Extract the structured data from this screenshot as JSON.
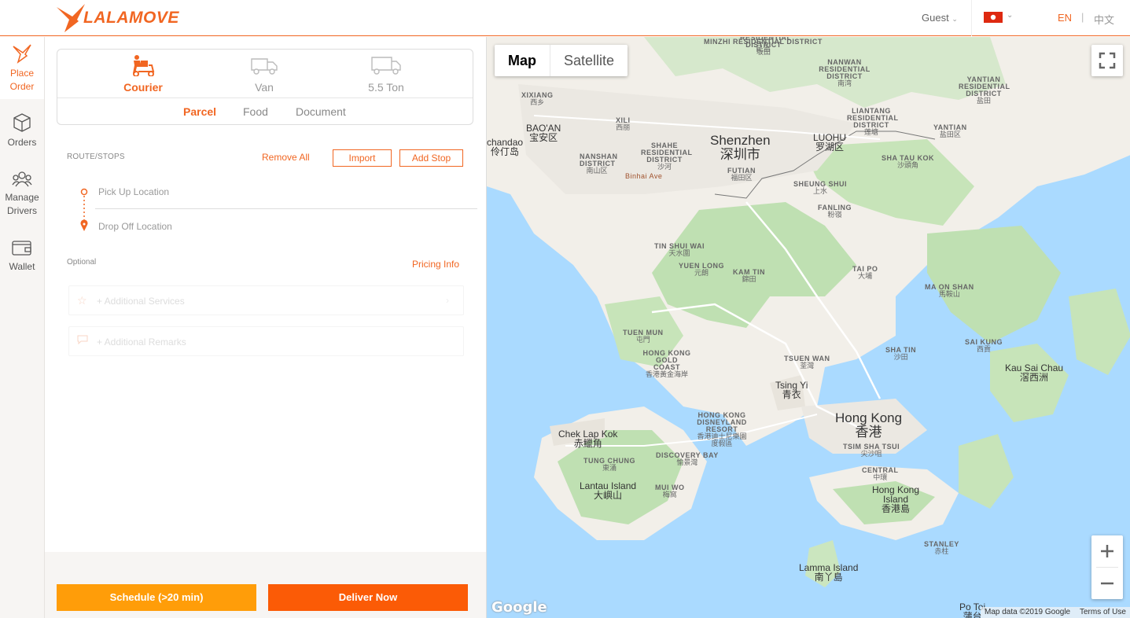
{
  "header": {
    "brand": "LALAMOVE",
    "user": "Guest",
    "lang_en": "EN",
    "lang_sep": "|",
    "lang_zh": "中文",
    "accent_color": "#f16622"
  },
  "nav": {
    "items": [
      {
        "label_1": "Place",
        "label_2": "Order",
        "icon": "bird-icon",
        "active": true
      },
      {
        "label_1": "Orders",
        "icon": "box-icon"
      },
      {
        "label_1": "Manage",
        "label_2": "Drivers",
        "icon": "drivers-icon"
      },
      {
        "label_1": "Wallet",
        "icon": "wallet-icon"
      }
    ]
  },
  "order": {
    "vehicles": [
      {
        "label": "Courier",
        "icon": "courier-icon",
        "active": true
      },
      {
        "label": "Van",
        "icon": "van-icon"
      },
      {
        "label": "5.5 Ton",
        "icon": "truck-icon"
      }
    ],
    "subtypes": [
      {
        "label": "Parcel",
        "active": true
      },
      {
        "label": "Food"
      },
      {
        "label": "Document"
      }
    ],
    "route_label": "ROUTE/STOPS",
    "remove_all": "Remove All",
    "import": "Import",
    "add_stop": "Add Stop",
    "pickup_placeholder": "Pick Up Location",
    "dropoff_placeholder": "Drop Off Location",
    "optional_label": "Optional",
    "pricing_info": "Pricing Info",
    "additional_services": "+ Additional Services",
    "additional_remarks": "+ Additional Remarks",
    "schedule_button": "Schedule (>20 min)",
    "deliver_now_button": "Deliver Now"
  },
  "map": {
    "type_map": "Map",
    "type_satellite": "Satellite",
    "google": "Google",
    "attribution": "Map data ©2019 Google",
    "terms": "Terms of Use",
    "labels": {
      "minzhi": "MINZHI RESIDENTIAL DISTRICT",
      "minzhi_zh": "民治",
      "jihua": "RESIDENTIAL DISTRICT",
      "jihua_zh": "坂田",
      "nanwan": "NANWAN RESIDENTIAL DISTRICT",
      "nanwan_zh": "南湾",
      "yantian_res": "YANTIAN RESIDENTIAL DISTRICT",
      "yantian_res_zh": "盐田",
      "xixiang": "XIXIANG",
      "xixiang_zh": "西乡",
      "baoan": "BAO'AN",
      "baoan_zh": "宝安区",
      "xili": "XILI",
      "xili_zh": "西丽",
      "liantang": "LIANTANG RESIDENTIAL DISTRICT",
      "liantang_zh": "莲塘",
      "yantian": "YANTIAN",
      "yantian_zh": "盐田区",
      "chandao": "chandao",
      "chandao_zh": "伶仃岛",
      "shenzhen": "Shenzhen",
      "shenzhen_zh": "深圳市",
      "luohu": "LUOHU",
      "luohu_zh": "罗湖区",
      "shahe": "SHAHE RESIDENTIAL DISTRICT",
      "shahe_zh": "沙河",
      "nanshan": "NANSHAN DISTRICT",
      "nanshan_zh": "南山区",
      "futian": "FUTIAN",
      "futian_zh": "福田区",
      "binhai": "Binhai Ave",
      "shatau": "SHA TAU KOK",
      "shatau_zh": "沙頭角",
      "sheungshui": "SHEUNG SHUI",
      "sheungshui_zh": "上水",
      "fanling": "FANLING",
      "fanling_zh": "粉嶺",
      "tinshuiwai": "TIN SHUI WAI",
      "tinshuiwai_zh": "天水圍",
      "yuenlong": "YUEN LONG",
      "yuenlong_zh": "元朗",
      "kamtin": "KAM TIN",
      "kamtin_zh": "錦田",
      "taipo": "TAI PO",
      "taipo_zh": "大埔",
      "maonshan": "MA ON SHAN",
      "maonshan_zh": "馬鞍山",
      "tuenmun": "TUEN MUN",
      "tuenmun_zh": "屯門",
      "goldcoast": "HONG KONG GOLD COAST",
      "goldcoast_zh": "香港黃金海岸",
      "shatin": "SHA TIN",
      "shatin_zh": "沙田",
      "saikung": "SAI KUNG",
      "saikung_zh": "西貢",
      "tsuenwan": "TSUEN WAN",
      "tsuenwan_zh": "荃灣",
      "kausaichau": "Kau Sai Chau",
      "kausaichau_zh": "滘西洲",
      "tsingyi": "Tsing Yi",
      "tsingyi_zh": "青衣",
      "disney": "HONG KONG DISNEYLAND RESORT",
      "disney_zh": "香港迪士尼樂園度假區",
      "hongkong": "Hong Kong",
      "hongkong_zh": "香港",
      "cheklapkok": "Chek Lap Kok",
      "cheklapkok_zh": "赤鱲角",
      "tsimshatsui": "TSIM SHA TSUI",
      "tsimshatsui_zh": "尖沙咀",
      "tungchung": "TUNG CHUNG",
      "tungchung_zh": "東涌",
      "discoverybay": "DISCOVERY BAY",
      "discoverybay_zh": "愉景灣",
      "central": "CENTRAL",
      "central_zh": "中環",
      "lantau": "Lantau Island",
      "lantau_zh": "大嶼山",
      "muiwo": "MUI WO",
      "muiwo_zh": "梅窩",
      "hkisland": "Hong Kong Island",
      "hkisland_zh": "香港島",
      "stanley": "STANLEY",
      "stanley_zh": "赤柱",
      "lamma": "Lamma Island",
      "lamma_zh": "南丫島",
      "potoi": "Po Toi",
      "potoi_zh": "蒲台"
    }
  }
}
